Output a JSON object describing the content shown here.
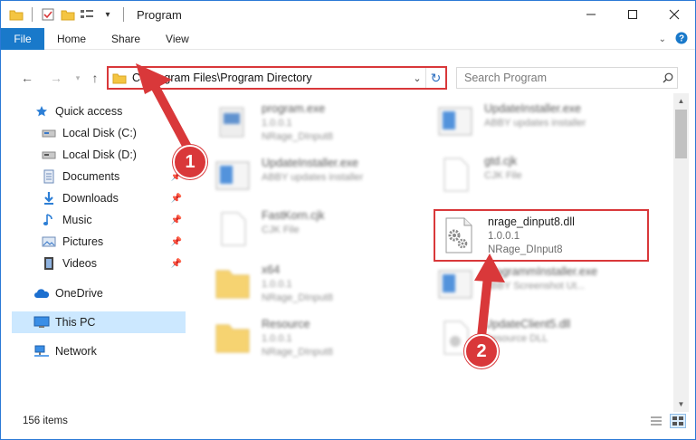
{
  "window": {
    "title": "Program",
    "controls": [
      "minimize-icon",
      "maximize-icon",
      "close-icon"
    ]
  },
  "ribbon": {
    "tabs": [
      "File",
      "Home",
      "Share",
      "View"
    ]
  },
  "address": {
    "path": "C:\\Program Files\\Program Directory",
    "search_placeholder": "Search Program"
  },
  "nav": {
    "items": [
      {
        "label": "Quick access",
        "icon": "star-icon"
      },
      {
        "label": "Local Disk (C:)",
        "icon": "drive-icon"
      },
      {
        "label": "Local Disk (D:)",
        "icon": "drive-icon"
      },
      {
        "label": "Documents",
        "icon": "documents-icon"
      },
      {
        "label": "Downloads",
        "icon": "downloads-icon"
      },
      {
        "label": "Music",
        "icon": "music-icon"
      },
      {
        "label": "Pictures",
        "icon": "pictures-icon"
      },
      {
        "label": "Videos",
        "icon": "videos-icon"
      },
      {
        "label": "OneDrive",
        "icon": "cloud-icon"
      },
      {
        "label": "This PC",
        "icon": "computer-icon",
        "selected": true
      },
      {
        "label": "Network",
        "icon": "network-icon"
      }
    ]
  },
  "files": [
    {
      "name": "program.exe",
      "sub1": "1.0.0.1",
      "sub2": "NRage_DInput8"
    },
    {
      "name": "UpdateInstaller.exe",
      "sub1": "ABBY updates installer",
      "sub2": ""
    },
    {
      "name": "UpdateInstaller.exe",
      "sub1": "ABBY updates installer",
      "sub2": ""
    },
    {
      "name": "gtd.cjk",
      "sub1": "CJK File",
      "sub2": ""
    },
    {
      "name": "FastKorn.cjk",
      "sub1": "CJK File",
      "sub2": ""
    },
    {
      "name": "x64",
      "sub1": "1.0.0.1",
      "sub2": "NRage_DInput8"
    },
    {
      "name": "ProgrammInstaller.exe",
      "sub1": "ABBY Screenshot Ut...",
      "sub2": ""
    },
    {
      "name": "Resource",
      "sub1": "1.0.0.1",
      "sub2": "NRage_DInput8"
    },
    {
      "name": "UpdateClient5.dll",
      "sub1": "Resource DLL",
      "sub2": ""
    }
  ],
  "highlighted_file": {
    "name": "nrage_dinput8.dll",
    "version": "1.0.0.1",
    "product": "NRage_DInput8"
  },
  "status": {
    "count": "156 items"
  },
  "annotations": {
    "badge1": "1",
    "badge2": "2",
    "color": "#d9383a"
  }
}
